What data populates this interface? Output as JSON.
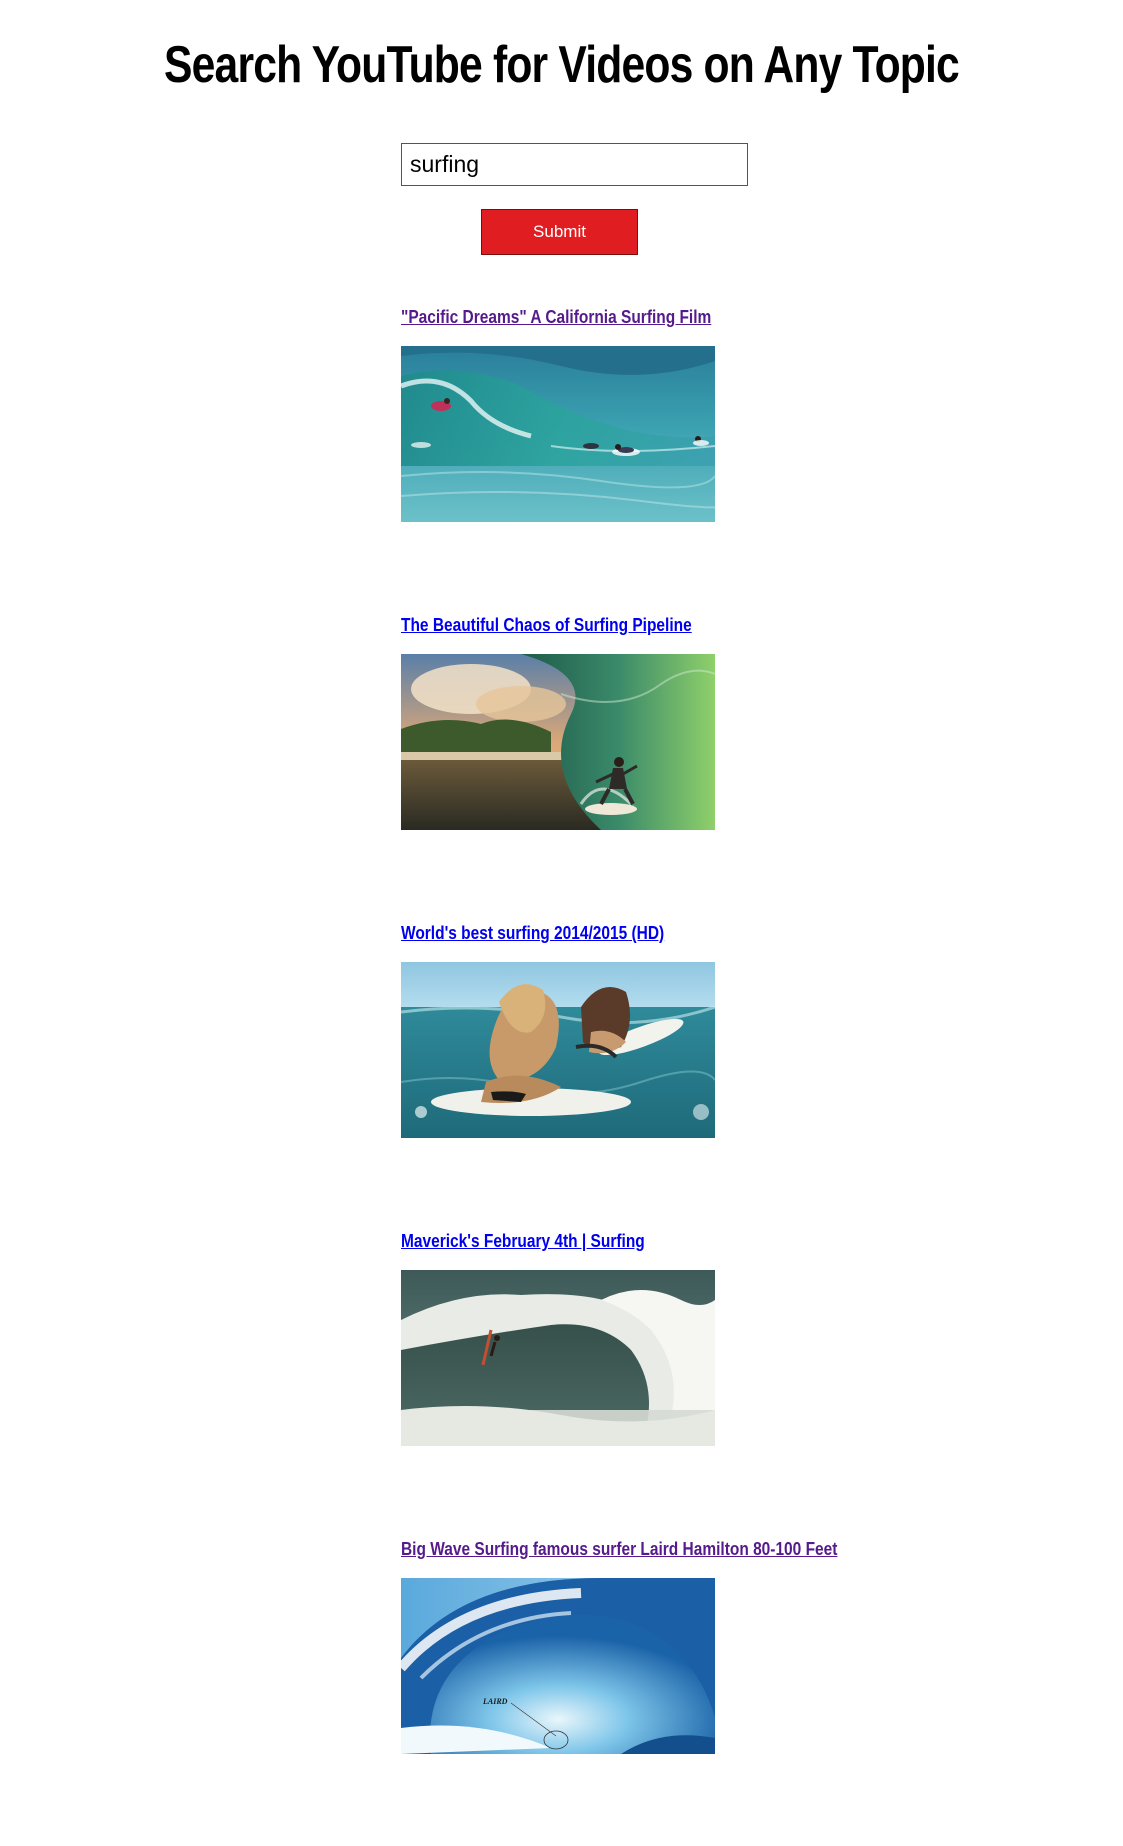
{
  "page": {
    "title": "Search YouTube for Videos on Any Topic"
  },
  "search": {
    "value": "surfing",
    "submit_label": "Submit"
  },
  "results": [
    {
      "title": "\"Pacific Dreams\" A California Surfing Film",
      "visited": true,
      "thumbnail": "surfers-paddling-wave"
    },
    {
      "title": "The Beautiful Chaos of Surfing Pipeline",
      "visited": false,
      "thumbnail": "surfer-in-barrel"
    },
    {
      "title": "World's best surfing 2014/2015 (HD)",
      "visited": false,
      "thumbnail": "two-surfers-on-boards"
    },
    {
      "title": "Maverick's February 4th | Surfing",
      "visited": false,
      "thumbnail": "big-wave-surfer"
    },
    {
      "title": "Big Wave Surfing famous surfer Laird Hamilton 80-100 Feet",
      "visited": true,
      "thumbnail": "blue-wave-curl",
      "thumbnail_caption": "LAIRD"
    }
  ],
  "colors": {
    "visited_link": "#551a8b",
    "unvisited_link": "#0000ee",
    "submit_bg": "#e01e22"
  }
}
